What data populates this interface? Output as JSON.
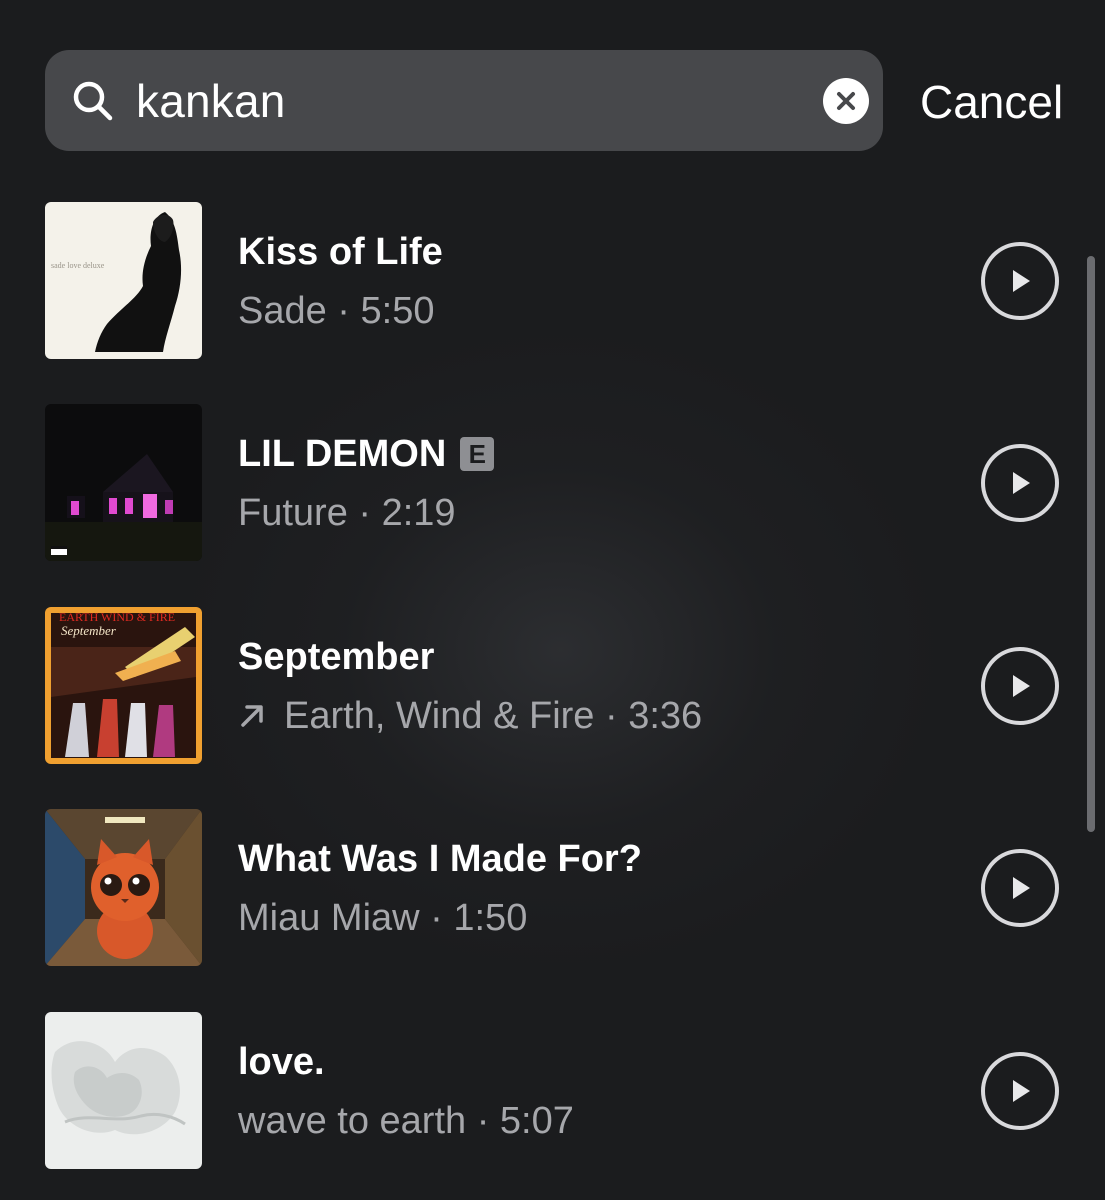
{
  "search": {
    "query": "kankan",
    "cancel_label": "Cancel"
  },
  "results": [
    {
      "title": "Kiss of Life",
      "artist": "Sade",
      "duration": "5:50",
      "subtitle": "Sade · 5:50",
      "explicit": false,
      "trending": false,
      "artwork_text": "sade love deluxe"
    },
    {
      "title": "LIL DEMON",
      "artist": "Future",
      "duration": "2:19",
      "subtitle": "Future · 2:19",
      "explicit": true,
      "explicit_label": "E",
      "trending": false
    },
    {
      "title": "September",
      "artist": "Earth, Wind & Fire",
      "duration": "3:36",
      "subtitle": "Earth, Wind & Fire · 3:36",
      "explicit": false,
      "trending": true,
      "artwork_text_top": "EARTH WIND & FIRE",
      "artwork_text_sub": "September"
    },
    {
      "title": "What Was I Made For?",
      "artist": "Miau Miaw",
      "duration": "1:50",
      "subtitle": "Miau Miaw · 1:50",
      "explicit": false,
      "trending": false
    },
    {
      "title": "love.",
      "artist": "wave to earth",
      "duration": "5:07",
      "subtitle": "wave to earth · 5:07",
      "explicit": false,
      "trending": false
    }
  ],
  "colors": {
    "background": "#1b1c1e",
    "search_field": "#47484b",
    "secondary_text": "#a6a7ab",
    "play_ring": "#d9d9dc"
  },
  "icons": {
    "search": "search-icon",
    "clear": "clear-icon",
    "play": "play-circle-icon",
    "trending": "trending-arrow-icon",
    "explicit": "explicit-badge"
  }
}
